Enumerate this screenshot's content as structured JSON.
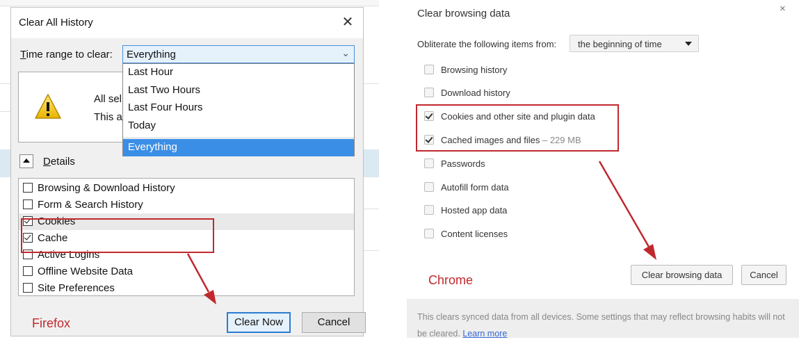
{
  "firefox": {
    "brand": "Firefox",
    "dialog_title": "Clear All History",
    "close_glyph": "✕",
    "time_range": {
      "label_prefix": "T",
      "label_rest": "ime range to clear:",
      "selected": "Everything",
      "options": [
        "Last Hour",
        "Last Two Hours",
        "Last Four Hours",
        "Today",
        "Everything"
      ]
    },
    "info": {
      "line1": "All sel",
      "line2": "This ac"
    },
    "details": {
      "label_prefix": "D",
      "label_rest": "etails"
    },
    "items": [
      {
        "label": "Browsing & Download History",
        "checked": false
      },
      {
        "label": "Form & Search History",
        "checked": false
      },
      {
        "label": "Cookies",
        "checked": true
      },
      {
        "label": "Cache",
        "checked": true
      },
      {
        "label": "Active Logins",
        "checked": false
      },
      {
        "label": "Offline Website Data",
        "checked": false
      },
      {
        "label": "Site Preferences",
        "checked": false
      }
    ],
    "buttons": {
      "clear_now": "Clear Now",
      "cancel": "Cancel"
    }
  },
  "chrome": {
    "brand": "Chrome",
    "dialog_title": "Clear browsing data",
    "close_glyph": "×",
    "obliterate_label": "Obliterate the following items from:",
    "obliterate_value": "the beginning of time",
    "items": [
      {
        "label": "Browsing history",
        "checked": false,
        "extra": ""
      },
      {
        "label": "Download history",
        "checked": false,
        "extra": ""
      },
      {
        "label": "Cookies and other site and plugin data",
        "checked": true,
        "extra": ""
      },
      {
        "label": "Cached images and files",
        "checked": true,
        "extra": " – 229 MB"
      },
      {
        "label": "Passwords",
        "checked": false,
        "extra": ""
      },
      {
        "label": "Autofill form data",
        "checked": false,
        "extra": ""
      },
      {
        "label": "Hosted app data",
        "checked": false,
        "extra": ""
      },
      {
        "label": "Content licenses",
        "checked": false,
        "extra": ""
      }
    ],
    "buttons": {
      "clear": "Clear browsing data",
      "cancel": "Cancel"
    },
    "footer": {
      "text": "This clears synced data from all devices. Some settings that may reflect browsing habits will not be cleared.",
      "link": "Learn more"
    }
  },
  "colors": {
    "annotation_red": "#c0282d",
    "firefox_selection_blue": "#3b8ee6",
    "chrome_link_blue": "#3367d6"
  }
}
